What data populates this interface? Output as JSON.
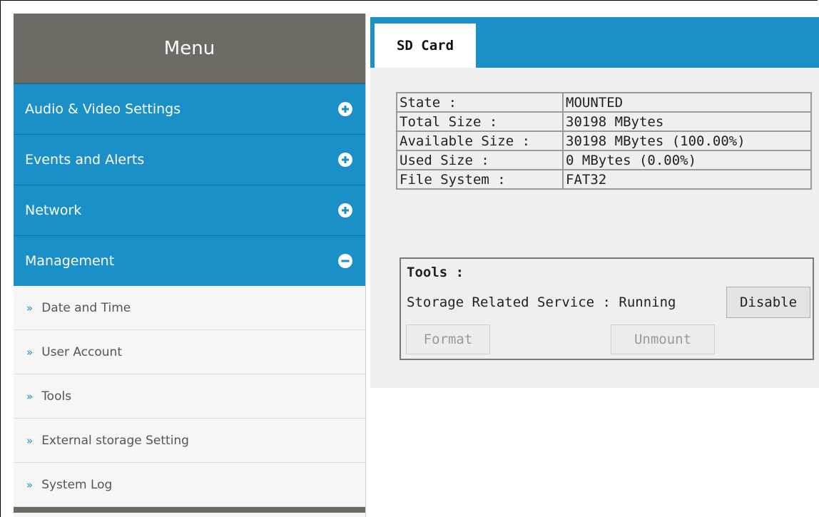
{
  "sidebar": {
    "title": "Menu",
    "sections": [
      {
        "label": "Audio & Video Settings",
        "state": "collapsed",
        "icon": "plus-circle-icon"
      },
      {
        "label": "Events and Alerts",
        "state": "collapsed",
        "icon": "plus-circle-icon"
      },
      {
        "label": "Network",
        "state": "collapsed",
        "icon": "plus-circle-icon"
      },
      {
        "label": "Management",
        "state": "expanded",
        "icon": "minus-circle-icon"
      }
    ],
    "sub_items": [
      {
        "label": "Date and Time"
      },
      {
        "label": "User Account"
      },
      {
        "label": "Tools"
      },
      {
        "label": "External storage Setting"
      },
      {
        "label": "System Log"
      }
    ],
    "bullet": "»"
  },
  "tab": {
    "label": "SD Card"
  },
  "info": {
    "rows": [
      {
        "key": "State :",
        "value": "MOUNTED"
      },
      {
        "key": "Total Size :",
        "value": "30198 MBytes"
      },
      {
        "key": "Available Size :",
        "value": "30198 MBytes (100.00%)"
      },
      {
        "key": "Used Size :",
        "value": "0 MBytes (0.00%)"
      },
      {
        "key": "File System :",
        "value": "FAT32"
      }
    ]
  },
  "tools": {
    "title": "Tools :",
    "service_text": "Storage Related Service : Running",
    "disable_label": "Disable",
    "format_label": "Format",
    "unmount_label": "Unmount"
  },
  "colors": {
    "accent_blue": "#1a8fc8",
    "menu_header": "#6e6a64",
    "panel_bg": "#efefef"
  }
}
